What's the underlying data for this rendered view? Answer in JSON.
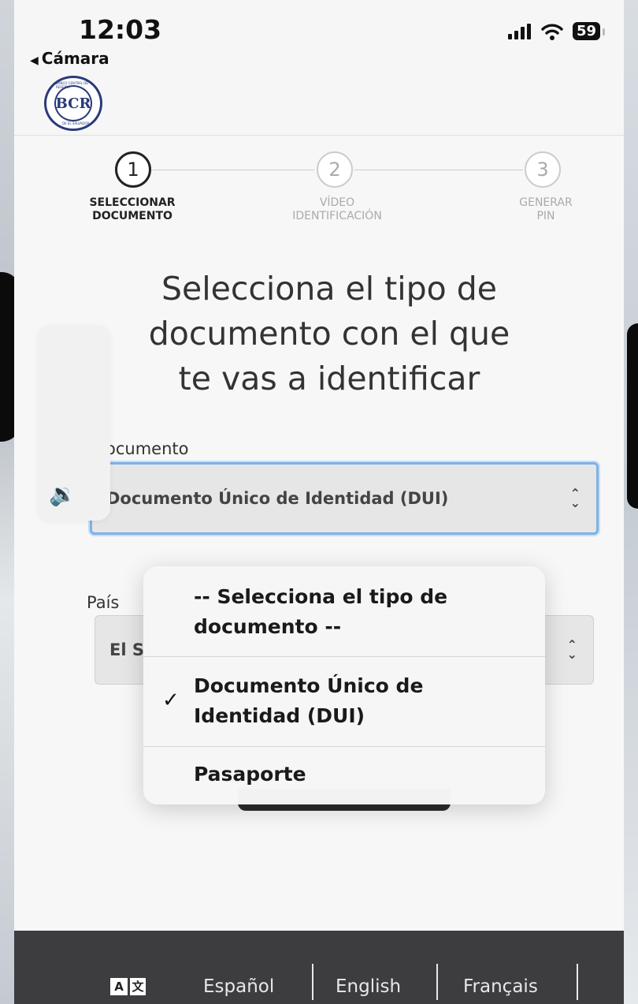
{
  "status_bar": {
    "time": "12:03",
    "back_label": "Cámara",
    "battery": "59"
  },
  "logo": {
    "monogram": "BCR",
    "ring_text_top": "BANCO CENTRAL DE RESERVA",
    "ring_text_bottom": "DE EL SALVADOR"
  },
  "stepper": {
    "steps": [
      {
        "number": "1",
        "label": "SELECCIONAR\nDOCUMENTO",
        "state": "active"
      },
      {
        "number": "2",
        "label": "VÍDEO\nIDENTIFICACIÓN",
        "state": "inactive"
      },
      {
        "number": "3",
        "label": "GENERAR\nPIN",
        "state": "inactive"
      }
    ]
  },
  "main": {
    "title": "Selecciona el tipo de\ndocumento con el que\nte vas a identificar",
    "document_label": "ocumento",
    "document_value": "Documento Único de Identidad (DUI)",
    "country_label": "País",
    "country_value": "El S"
  },
  "dropdown": {
    "options": [
      {
        "label": "-- Selecciona el tipo de\ndocumento --",
        "selected": false
      },
      {
        "label": "Documento Único de\nIdentidad (DUI)",
        "selected": true,
        "check": "✓"
      },
      {
        "label": "Pasaporte",
        "selected": false
      }
    ]
  },
  "footer": {
    "lang_icon_a": "A",
    "lang_icon_b": "文",
    "languages": [
      "Español",
      "English",
      "Français"
    ]
  },
  "colors": {
    "focus_border": "#7fb2e5",
    "footer_bg": "#3d3d3f",
    "logo_blue": "#2a3a7a"
  }
}
